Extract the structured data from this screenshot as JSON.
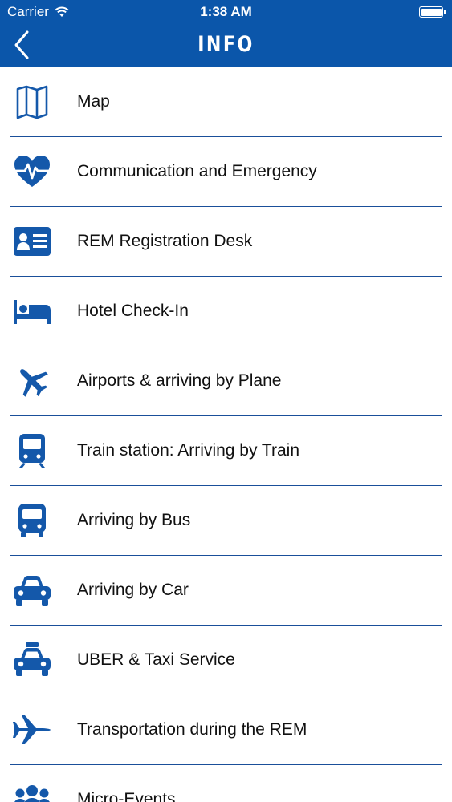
{
  "status_bar": {
    "carrier": "Carrier",
    "time": "1:38 AM",
    "wifi_icon": "wifi-icon",
    "battery_level": 1.0
  },
  "nav": {
    "title": "INFO",
    "back_icon": "chevron-left-icon"
  },
  "colors": {
    "header_background": "#0b56aa",
    "icon_color": "#1458aa",
    "divider_color": "#1a4f9a",
    "text_color": "#111111"
  },
  "items": [
    {
      "label": "Map",
      "icon": "map-icon"
    },
    {
      "label": "Communication and Emergency",
      "icon": "heart-pulse-icon"
    },
    {
      "label": "REM Registration Desk",
      "icon": "id-card-icon"
    },
    {
      "label": "Hotel Check-In",
      "icon": "bed-icon"
    },
    {
      "label": "Airports & arriving by Plane",
      "icon": "plane-icon"
    },
    {
      "label": "Train station: Arriving by Train",
      "icon": "train-icon"
    },
    {
      "label": "Arriving by Bus",
      "icon": "bus-icon"
    },
    {
      "label": "Arriving by Car",
      "icon": "car-icon"
    },
    {
      "label": "UBER & Taxi Service",
      "icon": "taxi-icon"
    },
    {
      "label": "Transportation during the REM",
      "icon": "jet-icon"
    },
    {
      "label": "Micro-Events",
      "icon": "group-icon"
    }
  ]
}
